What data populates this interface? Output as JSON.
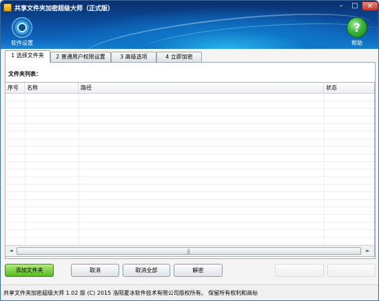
{
  "window": {
    "title": "共享文件夹加密超级大师（正式版）",
    "controls": {
      "minimize": "–",
      "maximize": "□",
      "close": "✕"
    }
  },
  "toolbar": {
    "settings_label": "软件设置",
    "settings_icon": "gear-icon",
    "help_label": "帮助",
    "help_icon": "help-icon",
    "help_glyph": "?"
  },
  "tabs": [
    {
      "label": "1 选择文件夹",
      "active": true
    },
    {
      "label": "2 普通用户权限设置",
      "active": false
    },
    {
      "label": "3 高级选项",
      "active": false
    },
    {
      "label": "4 立即加密",
      "active": false
    }
  ],
  "panel": {
    "list_caption": "文件夹列表：",
    "columns": [
      "序号",
      "名称",
      "路径",
      "状态"
    ],
    "rows": [],
    "scrollbar": {
      "left_arrow": "◄",
      "right_arrow": "►",
      "grip": "|||"
    }
  },
  "buttons": {
    "add_folder": "添加文件夹",
    "cancel": "取消",
    "cancel_all": "取消全部",
    "decrypt": "解密"
  },
  "status_bar": {
    "text": "共享文件夹加密超级大师 1.02 版  (C)  2015 洛阳夏冰软件技术有限公司版权所有。 保留所有权利和商标"
  },
  "colors": {
    "header_dark": "#0a2f6d",
    "header_light": "#1b86d6",
    "add_button_green": "#56b91f",
    "close_button_red": "#c1332a"
  }
}
